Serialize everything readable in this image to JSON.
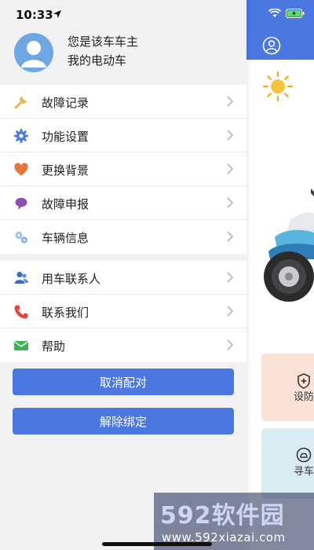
{
  "status_bar": {
    "time": "10:33"
  },
  "profile": {
    "line1": "您是该车车主",
    "line2": "我的电动车"
  },
  "menu_group_1": [
    {
      "label": "故障记录",
      "icon": "wrench-icon",
      "color": "#e8b74a"
    },
    {
      "label": "功能设置",
      "icon": "gear-icon",
      "color": "#4a78e0"
    },
    {
      "label": "更换背景",
      "icon": "heart-icon",
      "color": "#e8743a"
    },
    {
      "label": "故障申报",
      "icon": "speech-bubble-icon",
      "color": "#8a4fb0"
    },
    {
      "label": "车辆信息",
      "icon": "gears-icon",
      "color": "#7fa8e8"
    }
  ],
  "menu_group_2": [
    {
      "label": "用车联系人",
      "icon": "contacts-icon",
      "color": "#3b6fc4"
    },
    {
      "label": "联系我们",
      "icon": "phone-icon",
      "color": "#e0443a"
    },
    {
      "label": "帮助",
      "icon": "mail-icon",
      "color": "#3cb35a"
    }
  ],
  "buttons": {
    "unpair": "取消配对",
    "unbind": "解除绑定"
  },
  "background_app": {
    "header_color": "#4a78e0",
    "cards": [
      {
        "label": "设防",
        "icon": "shield-plus-icon"
      },
      {
        "label": "寻车",
        "icon": "car-search-icon"
      }
    ]
  },
  "watermark": {
    "logo": "592软件园",
    "url": "www.592xiazai.com"
  }
}
